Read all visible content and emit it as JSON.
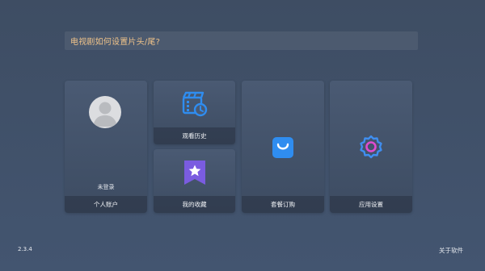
{
  "banner": {
    "text": "电视剧如何设置片头/尾?"
  },
  "tiles": {
    "account": {
      "status": "未登录",
      "label": "个人账户",
      "icon": "avatar-icon"
    },
    "history": {
      "label": "观看历史",
      "icon": "clapperboard-clock-icon"
    },
    "favorites": {
      "label": "我的收藏",
      "icon": "star-bookmark-icon"
    },
    "subscription": {
      "label": "套餐订购",
      "icon": "shopping-bag-icon"
    },
    "settings": {
      "label": "应用设置",
      "icon": "gear-icon"
    }
  },
  "footer": {
    "version": "2.3.4",
    "about_label": "关于软件"
  },
  "colors": {
    "background": "#3e4d63",
    "banner_text": "#f0c38a",
    "accent_blue": "#2f8df0",
    "accent_purple": "#7a5ce0",
    "gear_pink": "#e04bd0"
  }
}
